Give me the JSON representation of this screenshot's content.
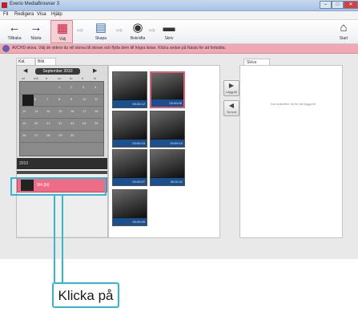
{
  "window": {
    "title": "Everio MediaBrowser 3",
    "buttons": {
      "minimize": "–",
      "maximize": "□",
      "close": "✕"
    }
  },
  "menu": [
    "Fil",
    "Redigera",
    "Visa",
    "Hjälp"
  ],
  "toolbar": {
    "items": [
      {
        "label": "Tillbaka",
        "icon": "back-arrow-icon",
        "glyph": "←"
      },
      {
        "label": "Nästa",
        "icon": "forward-arrow-icon",
        "glyph": "→"
      },
      {
        "label": "Välj",
        "icon": "select-icon",
        "glyph": "▦"
      },
      {
        "label": "Skapa",
        "icon": "create-icon",
        "glyph": "▤"
      },
      {
        "label": "Bekräfta",
        "icon": "confirm-icon",
        "glyph": "◉"
      },
      {
        "label": "Skriv",
        "icon": "write-disc-icon",
        "glyph": "▬"
      },
      {
        "label": "Start",
        "icon": "home-icon",
        "glyph": "⌂"
      }
    ]
  },
  "banner": {
    "text": "AVCHD-skiva. Välj de videor du vill skriva till skivan och flytta dem till högra listan. Klicka sedan på Nästa för att fortsätta."
  },
  "tabs": {
    "calendar": "Kal.",
    "library": "Bibl."
  },
  "calendar": {
    "month": "September 2010",
    "weekdays": [
      "sö",
      "må",
      "ti",
      "on",
      "to",
      "fr",
      "lö"
    ],
    "rows": [
      [
        "",
        "",
        "",
        "1",
        "2",
        "3",
        "4"
      ],
      [
        "5",
        "6",
        "7",
        "8",
        "9",
        "10",
        "11"
      ],
      [
        "12",
        "13",
        "14",
        "15",
        "16",
        "17",
        "18"
      ],
      [
        "19",
        "20",
        "21",
        "22",
        "23",
        "24",
        "25"
      ],
      [
        "26",
        "27",
        "28",
        "29",
        "30",
        "",
        ""
      ]
    ]
  },
  "date_list": {
    "header": "2010",
    "selected_item": "9/4 (lö)"
  },
  "thumbnails": [
    {
      "caption": "00:00:12"
    },
    {
      "caption": "00:00:08"
    },
    {
      "caption": "00:00:15"
    },
    {
      "caption": "00:00:10"
    },
    {
      "caption": "00:00:07"
    },
    {
      "caption": "00:00:11"
    },
    {
      "caption": "00:00:09"
    }
  ],
  "middle_buttons": [
    {
      "label": "Lägg till",
      "glyph": "▶"
    },
    {
      "label": "Ta bort",
      "glyph": "◀"
    }
  ],
  "right_panel": {
    "tab": "Skiva",
    "message": "Dra videofiler hit för att lägga till."
  },
  "callout": {
    "text": "Klicka på"
  },
  "colors": {
    "accent_pink": "#ee6d86",
    "callout_blue": "#33b7d4",
    "thumb_caption_blue": "#1c4f8e"
  }
}
